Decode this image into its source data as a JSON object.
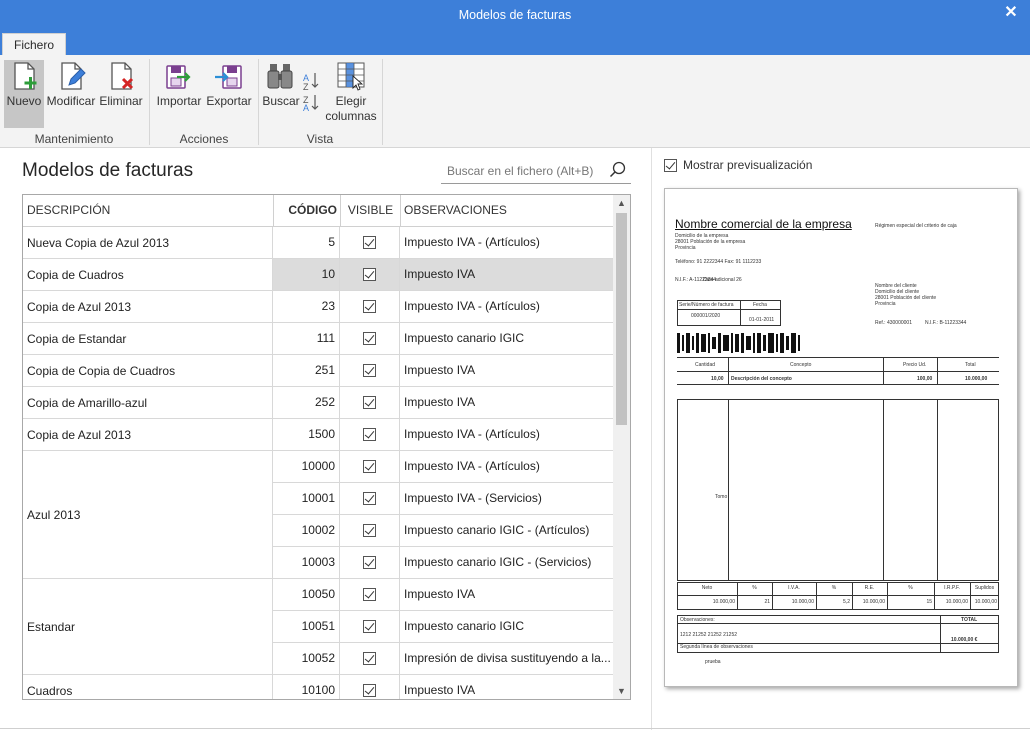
{
  "window": {
    "title": "Modelos de facturas",
    "close": "✕"
  },
  "tabs": {
    "fichero": "Fichero"
  },
  "ribbon": {
    "buttons": {
      "nuevo": "Nuevo",
      "modificar": "Modificar",
      "eliminar": "Eliminar",
      "importar": "Importar",
      "exportar": "Exportar",
      "buscar": "Buscar",
      "elegir": "Elegir",
      "columnas": "columnas"
    },
    "groups": {
      "mantenimiento": "Mantenimiento",
      "acciones": "Acciones",
      "vista": "Vista"
    }
  },
  "main": {
    "title": "Modelos de facturas",
    "search_placeholder": "Buscar en el fichero (Alt+B)"
  },
  "grid": {
    "headers": {
      "descripcion": "DESCRIPCIÓN",
      "codigo": "CÓDIGO",
      "visible": "VISIBLE",
      "observaciones": "OBSERVACIONES"
    },
    "groups": [
      {
        "desc": "Nueva Copia de Azul 2013",
        "rows": [
          {
            "code": "5",
            "obs": "Impuesto IVA - (Artículos)"
          }
        ]
      },
      {
        "desc": "Copia de Cuadros",
        "selected": true,
        "rows": [
          {
            "code": "10",
            "obs": "Impuesto IVA"
          }
        ]
      },
      {
        "desc": "Copia de Azul 2013",
        "rows": [
          {
            "code": "23",
            "obs": "Impuesto IVA - (Artículos)"
          }
        ]
      },
      {
        "desc": "Copia de Estandar",
        "rows": [
          {
            "code": "111",
            "obs": "Impuesto canario IGIC"
          }
        ]
      },
      {
        "desc": "Copia de Copia de Cuadros",
        "rows": [
          {
            "code": "251",
            "obs": "Impuesto IVA"
          }
        ]
      },
      {
        "desc": "Copia de Amarillo-azul",
        "rows": [
          {
            "code": "252",
            "obs": "Impuesto IVA"
          }
        ]
      },
      {
        "desc": "Copia de Azul 2013",
        "rows": [
          {
            "code": "1500",
            "obs": "Impuesto IVA - (Artículos)"
          }
        ]
      },
      {
        "desc": "Azul 2013",
        "rows": [
          {
            "code": "10000",
            "obs": "Impuesto IVA - (Artículos)"
          },
          {
            "code": "10001",
            "obs": "Impuesto IVA - (Servicios)"
          },
          {
            "code": "10002",
            "obs": "Impuesto canario IGIC - (Artículos)"
          },
          {
            "code": "10003",
            "obs": "Impuesto canario IGIC - (Servicios)"
          }
        ]
      },
      {
        "desc": "Estandar",
        "rows": [
          {
            "code": "10050",
            "obs": "Impuesto IVA"
          },
          {
            "code": "10051",
            "obs": "Impuesto canario IGIC"
          },
          {
            "code": "10052",
            "obs": "Impresión de divisa sustituyendo a la..."
          }
        ]
      },
      {
        "desc": "Cuadros",
        "rows": [
          {
            "code": "10100",
            "obs": "Impuesto IVA"
          }
        ]
      }
    ]
  },
  "preview": {
    "toggle_label": "Mostrar previsualización",
    "company_name": "Nombre comercial de la empresa",
    "regime": "Régimen especial del criterio de caja",
    "company_lines": [
      "Domicilio de la empresa",
      "28001     Población de la empresa",
      "Provincia"
    ],
    "phone": "Teléfono:  91 2222344   Fax:   91 1112233",
    "nif": "N.I.F.:   A-11223344",
    "nif_extra": "Dato adicional 26",
    "client_lines": [
      "Nombre del cliente",
      "Domicilio del cliente",
      "28001  Población del cliente",
      "Provincia"
    ],
    "ref": "Ref.:   430000001",
    "client_nif": "N.I.F.:     B-11223344",
    "serie_label": "Serie/Número de factura",
    "fecha_label": "Fecha",
    "serie_value": "000001/2020",
    "fecha_value": "01-01-2011",
    "col_cantidad": "Cantidad",
    "col_concepto": "Concepto",
    "col_precio": "Precio Ud.",
    "col_total": "Total",
    "line_cantidad": "10,00",
    "line_concepto": "Descripción del concepto",
    "line_precio": "100,00",
    "line_total": "10.000,00",
    "tomo": "Tomo",
    "tot_headers": [
      "Neto",
      "%",
      "I.V.A.",
      "%",
      "R.E.",
      "%",
      "I.R.P.F.",
      "Suplidos"
    ],
    "tot_values": [
      "10.000,00",
      "21",
      "10.000,00",
      "5,2",
      "10.000,00",
      "15",
      "10.000,00",
      "10.000,00"
    ],
    "observaciones": "Observaciones:",
    "obs_line": "1212 21252 21252 21252",
    "obs_second": "Segunda línea de observaciones",
    "total_label": "TOTAL",
    "total_value": "10.000,00 €",
    "prueba": "prueba"
  }
}
